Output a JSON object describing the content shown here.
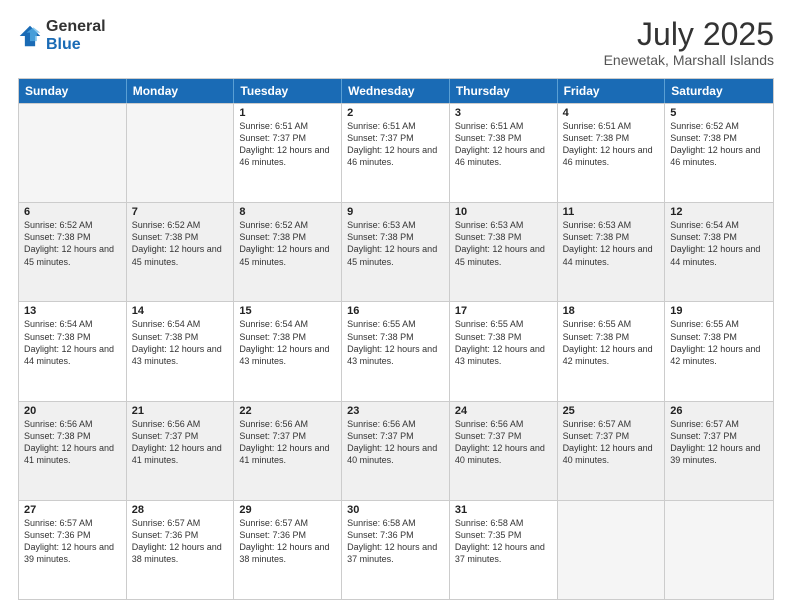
{
  "logo": {
    "line1": "General",
    "line2": "Blue"
  },
  "title": "July 2025",
  "subtitle": "Enewetak, Marshall Islands",
  "weekdays": [
    "Sunday",
    "Monday",
    "Tuesday",
    "Wednesday",
    "Thursday",
    "Friday",
    "Saturday"
  ],
  "weeks": [
    [
      {
        "day": "",
        "info": ""
      },
      {
        "day": "",
        "info": ""
      },
      {
        "day": "1",
        "info": "Sunrise: 6:51 AM\nSunset: 7:37 PM\nDaylight: 12 hours and 46 minutes."
      },
      {
        "day": "2",
        "info": "Sunrise: 6:51 AM\nSunset: 7:37 PM\nDaylight: 12 hours and 46 minutes."
      },
      {
        "day": "3",
        "info": "Sunrise: 6:51 AM\nSunset: 7:38 PM\nDaylight: 12 hours and 46 minutes."
      },
      {
        "day": "4",
        "info": "Sunrise: 6:51 AM\nSunset: 7:38 PM\nDaylight: 12 hours and 46 minutes."
      },
      {
        "day": "5",
        "info": "Sunrise: 6:52 AM\nSunset: 7:38 PM\nDaylight: 12 hours and 46 minutes."
      }
    ],
    [
      {
        "day": "6",
        "info": "Sunrise: 6:52 AM\nSunset: 7:38 PM\nDaylight: 12 hours and 45 minutes."
      },
      {
        "day": "7",
        "info": "Sunrise: 6:52 AM\nSunset: 7:38 PM\nDaylight: 12 hours and 45 minutes."
      },
      {
        "day": "8",
        "info": "Sunrise: 6:52 AM\nSunset: 7:38 PM\nDaylight: 12 hours and 45 minutes."
      },
      {
        "day": "9",
        "info": "Sunrise: 6:53 AM\nSunset: 7:38 PM\nDaylight: 12 hours and 45 minutes."
      },
      {
        "day": "10",
        "info": "Sunrise: 6:53 AM\nSunset: 7:38 PM\nDaylight: 12 hours and 45 minutes."
      },
      {
        "day": "11",
        "info": "Sunrise: 6:53 AM\nSunset: 7:38 PM\nDaylight: 12 hours and 44 minutes."
      },
      {
        "day": "12",
        "info": "Sunrise: 6:54 AM\nSunset: 7:38 PM\nDaylight: 12 hours and 44 minutes."
      }
    ],
    [
      {
        "day": "13",
        "info": "Sunrise: 6:54 AM\nSunset: 7:38 PM\nDaylight: 12 hours and 44 minutes."
      },
      {
        "day": "14",
        "info": "Sunrise: 6:54 AM\nSunset: 7:38 PM\nDaylight: 12 hours and 43 minutes."
      },
      {
        "day": "15",
        "info": "Sunrise: 6:54 AM\nSunset: 7:38 PM\nDaylight: 12 hours and 43 minutes."
      },
      {
        "day": "16",
        "info": "Sunrise: 6:55 AM\nSunset: 7:38 PM\nDaylight: 12 hours and 43 minutes."
      },
      {
        "day": "17",
        "info": "Sunrise: 6:55 AM\nSunset: 7:38 PM\nDaylight: 12 hours and 43 minutes."
      },
      {
        "day": "18",
        "info": "Sunrise: 6:55 AM\nSunset: 7:38 PM\nDaylight: 12 hours and 42 minutes."
      },
      {
        "day": "19",
        "info": "Sunrise: 6:55 AM\nSunset: 7:38 PM\nDaylight: 12 hours and 42 minutes."
      }
    ],
    [
      {
        "day": "20",
        "info": "Sunrise: 6:56 AM\nSunset: 7:38 PM\nDaylight: 12 hours and 41 minutes."
      },
      {
        "day": "21",
        "info": "Sunrise: 6:56 AM\nSunset: 7:37 PM\nDaylight: 12 hours and 41 minutes."
      },
      {
        "day": "22",
        "info": "Sunrise: 6:56 AM\nSunset: 7:37 PM\nDaylight: 12 hours and 41 minutes."
      },
      {
        "day": "23",
        "info": "Sunrise: 6:56 AM\nSunset: 7:37 PM\nDaylight: 12 hours and 40 minutes."
      },
      {
        "day": "24",
        "info": "Sunrise: 6:56 AM\nSunset: 7:37 PM\nDaylight: 12 hours and 40 minutes."
      },
      {
        "day": "25",
        "info": "Sunrise: 6:57 AM\nSunset: 7:37 PM\nDaylight: 12 hours and 40 minutes."
      },
      {
        "day": "26",
        "info": "Sunrise: 6:57 AM\nSunset: 7:37 PM\nDaylight: 12 hours and 39 minutes."
      }
    ],
    [
      {
        "day": "27",
        "info": "Sunrise: 6:57 AM\nSunset: 7:36 PM\nDaylight: 12 hours and 39 minutes."
      },
      {
        "day": "28",
        "info": "Sunrise: 6:57 AM\nSunset: 7:36 PM\nDaylight: 12 hours and 38 minutes."
      },
      {
        "day": "29",
        "info": "Sunrise: 6:57 AM\nSunset: 7:36 PM\nDaylight: 12 hours and 38 minutes."
      },
      {
        "day": "30",
        "info": "Sunrise: 6:58 AM\nSunset: 7:36 PM\nDaylight: 12 hours and 37 minutes."
      },
      {
        "day": "31",
        "info": "Sunrise: 6:58 AM\nSunset: 7:35 PM\nDaylight: 12 hours and 37 minutes."
      },
      {
        "day": "",
        "info": ""
      },
      {
        "day": "",
        "info": ""
      }
    ]
  ]
}
